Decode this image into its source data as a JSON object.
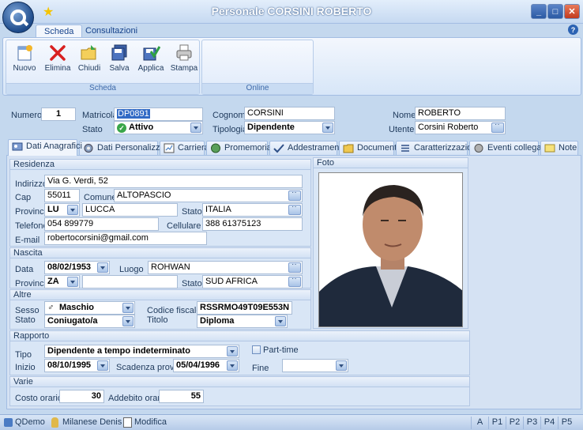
{
  "window": {
    "title": "Personale CORSINI ROBERTO",
    "min": "_",
    "max": "□",
    "close": "✕",
    "help": "?"
  },
  "ribbon": {
    "tabs": [
      "Scheda",
      "Consultazioni"
    ],
    "buttons": [
      {
        "label": "Nuovo",
        "icon": "new-icon"
      },
      {
        "label": "Elimina",
        "icon": "delete-icon"
      },
      {
        "label": "Chiudi",
        "icon": "close-folder-icon"
      },
      {
        "label": "Salva",
        "icon": "save-icon"
      },
      {
        "label": "Applica",
        "icon": "apply-icon"
      },
      {
        "label": "Stampa",
        "icon": "print-icon"
      }
    ],
    "groups": [
      "Scheda",
      "Online"
    ]
  },
  "header": {
    "numero_label": "Numero",
    "numero": "1",
    "matricola_label": "Matricola",
    "matricola": "DP0891",
    "cognome_label": "Cognome",
    "cognome": "CORSINI",
    "nome_label": "Nome",
    "nome": "ROBERTO",
    "stato_label": "Stato",
    "stato": "Attivo",
    "tipologia_label": "Tipologia",
    "tipologia": "Dipendente",
    "utente_label": "Utente",
    "utente": "Corsini Roberto"
  },
  "tabs": [
    "Dati Anagrafici",
    "Dati Personalizzati",
    "Carriera",
    "Promemoria",
    "Addestramenti",
    "Documenti",
    "Caratterizzazioni",
    "Eventi collegati",
    "Note"
  ],
  "residenza": {
    "title": "Residenza",
    "indirizzo_label": "Indirizzo",
    "indirizzo": "Via G. Verdi, 52",
    "cap_label": "Cap",
    "cap": "55011",
    "comune_label": "Comune",
    "comune": "ALTOPASCIO",
    "provincia_label": "Provincia",
    "provincia": "LU",
    "provincia_nome": "LUCCA",
    "stato_label": "Stato",
    "stato": "ITALIA",
    "telefono_label": "Telefono",
    "telefono": "054 899779",
    "cellulare_label": "Cellulare",
    "cellulare": "388 61375123",
    "email_label": "E-mail",
    "email": "robertocorsini@gmail.com"
  },
  "foto": {
    "title": "Foto"
  },
  "nascita": {
    "title": "Nascita",
    "data_label": "Data",
    "data": "08/02/1953",
    "luogo_label": "Luogo",
    "luogo": "ROHWAN",
    "provincia_label": "Provincia",
    "provincia": "ZA",
    "stato_label": "Stato",
    "stato": "SUD AFRICA"
  },
  "altre": {
    "title": "Altre",
    "sesso_label": "Sesso",
    "sesso": "Maschio",
    "stato_label": "Stato",
    "stato": "Coniugato/a",
    "cf_label": "Codice fiscale",
    "cf": "RSSRMO49T09E553N",
    "titolo_label": "Titolo",
    "titolo": "Diploma"
  },
  "rapporto": {
    "title": "Rapporto",
    "tipo_label": "Tipo",
    "tipo": "Dipendente a tempo indeterminato",
    "parttime_label": "Part-time",
    "inizio_label": "Inizio",
    "inizio": "08/10/1995",
    "scadenza_label": "Scadenza prova",
    "scadenza": "05/04/1996",
    "fine_label": "Fine",
    "fine": ""
  },
  "varie": {
    "title": "Varie",
    "costo_label": "Costo orario",
    "costo": "30",
    "addebito_label": "Addebito orario",
    "addebito": "55"
  },
  "status": {
    "left": [
      "QDemo",
      "Milanese Denis",
      "Modifica"
    ],
    "keys": [
      "A",
      "P1",
      "P2",
      "P3",
      "P4",
      "P5"
    ]
  }
}
